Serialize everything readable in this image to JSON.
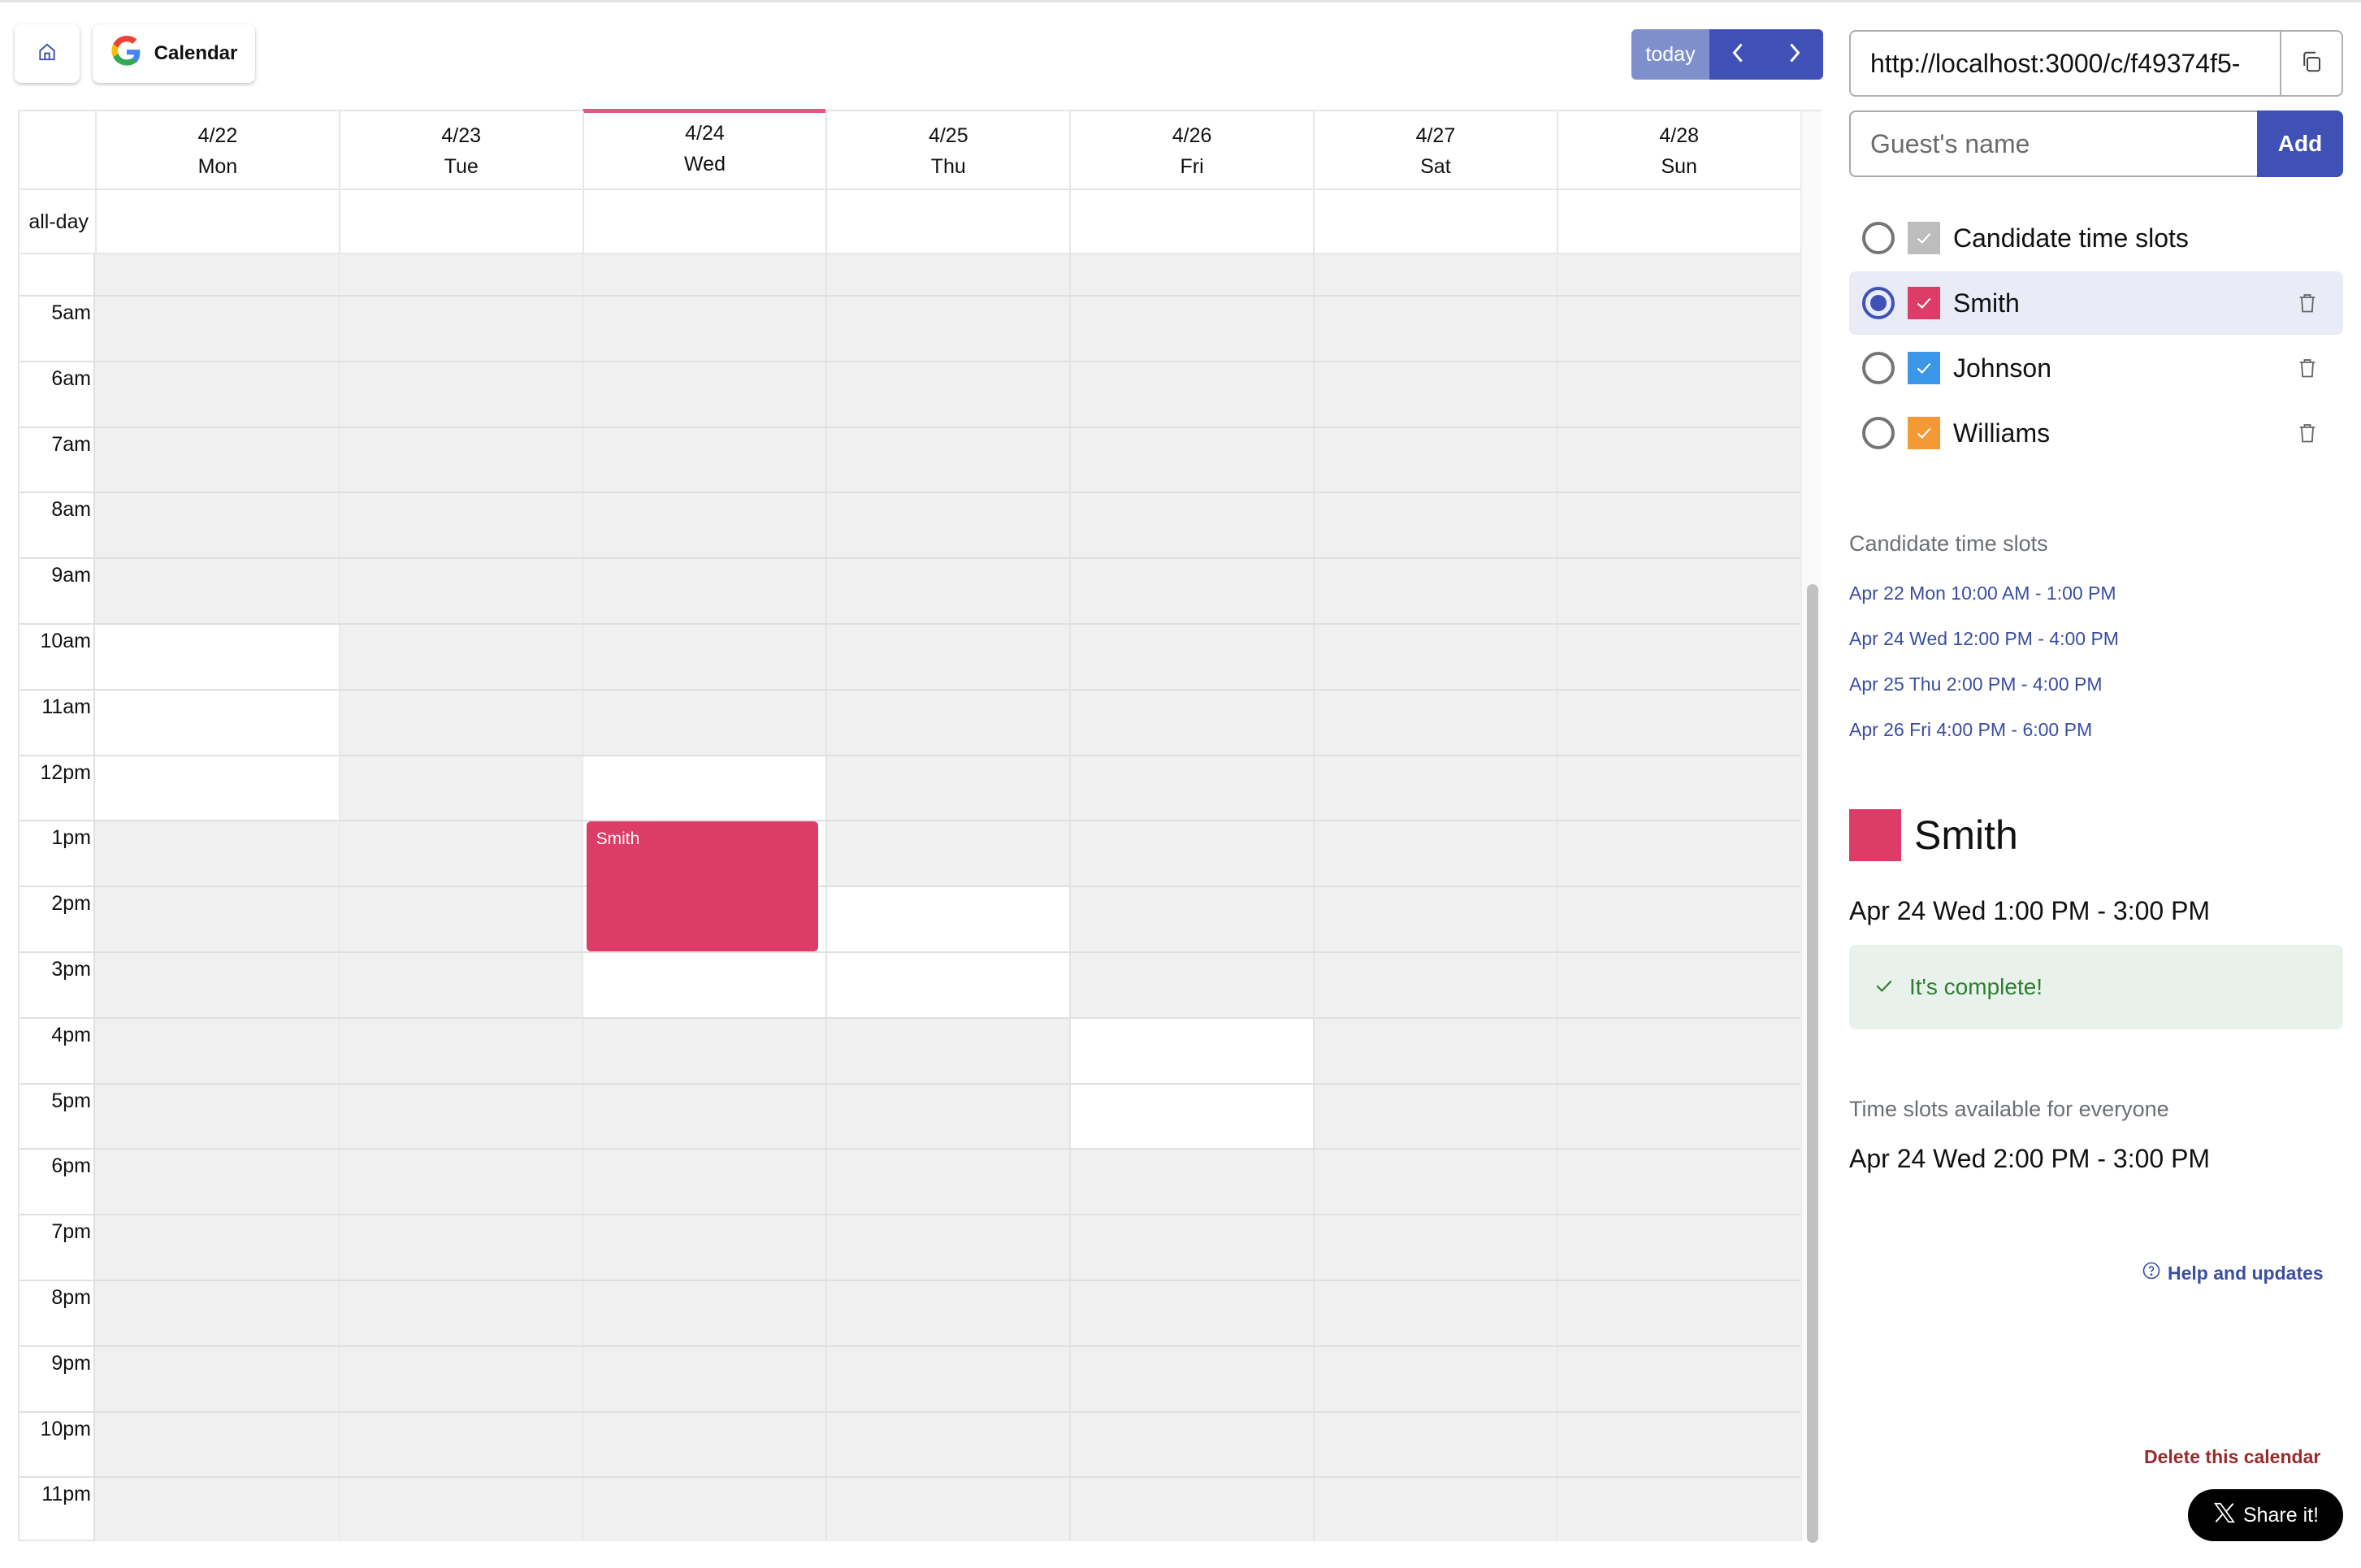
{
  "toolbar": {
    "home_icon": "home-icon",
    "calendar_button_label": "Calendar",
    "calendar_icon": "google-g-icon",
    "today_label": "today",
    "prev_icon": "chevron-left-icon",
    "next_icon": "chevron-right-icon"
  },
  "calendar": {
    "all_day_label": "all-day",
    "days": [
      {
        "date": "4/22",
        "weekday": "Mon",
        "today": false
      },
      {
        "date": "4/23",
        "weekday": "Tue",
        "today": false
      },
      {
        "date": "4/24",
        "weekday": "Wed",
        "today": true
      },
      {
        "date": "4/25",
        "weekday": "Thu",
        "today": false
      },
      {
        "date": "4/26",
        "weekday": "Fri",
        "today": false
      },
      {
        "date": "4/27",
        "weekday": "Sat",
        "today": false
      },
      {
        "date": "4/28",
        "weekday": "Sun",
        "today": false
      }
    ],
    "visible_start_hour": 4.38,
    "hours": [
      "5am",
      "6am",
      "7am",
      "8am",
      "9am",
      "10am",
      "11am",
      "12pm",
      "1pm",
      "2pm",
      "3pm",
      "4pm",
      "5pm",
      "6pm",
      "7pm",
      "8pm",
      "9pm",
      "10pm",
      "11pm"
    ],
    "hour_values": [
      5,
      6,
      7,
      8,
      9,
      10,
      11,
      12,
      13,
      14,
      15,
      16,
      17,
      18,
      19,
      20,
      21,
      22,
      23
    ],
    "available_blocks": [
      {
        "day": 0,
        "start": 10,
        "end": 13
      },
      {
        "day": 2,
        "start": 12,
        "end": 16
      },
      {
        "day": 3,
        "start": 14,
        "end": 16
      },
      {
        "day": 4,
        "start": 16,
        "end": 18
      }
    ],
    "events": [
      {
        "title": "Smith",
        "day": 2,
        "start": 13,
        "end": 15,
        "color": "#dc3c65"
      }
    ],
    "scroll_position": 0.28
  },
  "panel": {
    "url_value": "http://localhost:3000/c/f49374f5-",
    "copy_icon": "copy-icon",
    "guest_placeholder": "Guest's name",
    "guest_value": "",
    "add_label": "Add",
    "guests": [
      {
        "name": "Candidate time slots",
        "color": "#bdbdbd",
        "checked": true,
        "selected": false,
        "deletable": false
      },
      {
        "name": "Smith",
        "color": "#dc3c65",
        "checked": true,
        "selected": true,
        "deletable": true
      },
      {
        "name": "Johnson",
        "color": "#3a96e8",
        "checked": true,
        "selected": false,
        "deletable": true
      },
      {
        "name": "Williams",
        "color": "#f39a37",
        "checked": true,
        "selected": false,
        "deletable": true
      }
    ],
    "candidate_heading": "Candidate time slots",
    "candidate_slots": [
      "Apr 22 Mon 10:00 AM - 1:00 PM",
      "Apr 24 Wed 12:00 PM - 4:00 PM",
      "Apr 25 Thu 2:00 PM - 4:00 PM",
      "Apr 26 Fri 4:00 PM - 6:00 PM"
    ],
    "selected_guest": {
      "name": "Smith",
      "color": "#dc3c65",
      "time": "Apr 24 Wed 1:00 PM - 3:00 PM",
      "status": "It's complete!"
    },
    "everyone_heading": "Time slots available for everyone",
    "everyone_slot": "Apr 24 Wed 2:00 PM - 3:00 PM",
    "help_label": "Help and updates",
    "delete_label": "Delete this calendar",
    "share_label": "Share it!"
  },
  "colors": {
    "accent": "#3f51b5",
    "today_marker": "#e05b82",
    "success": "#2e7d32",
    "danger": "#9b2a2a"
  }
}
